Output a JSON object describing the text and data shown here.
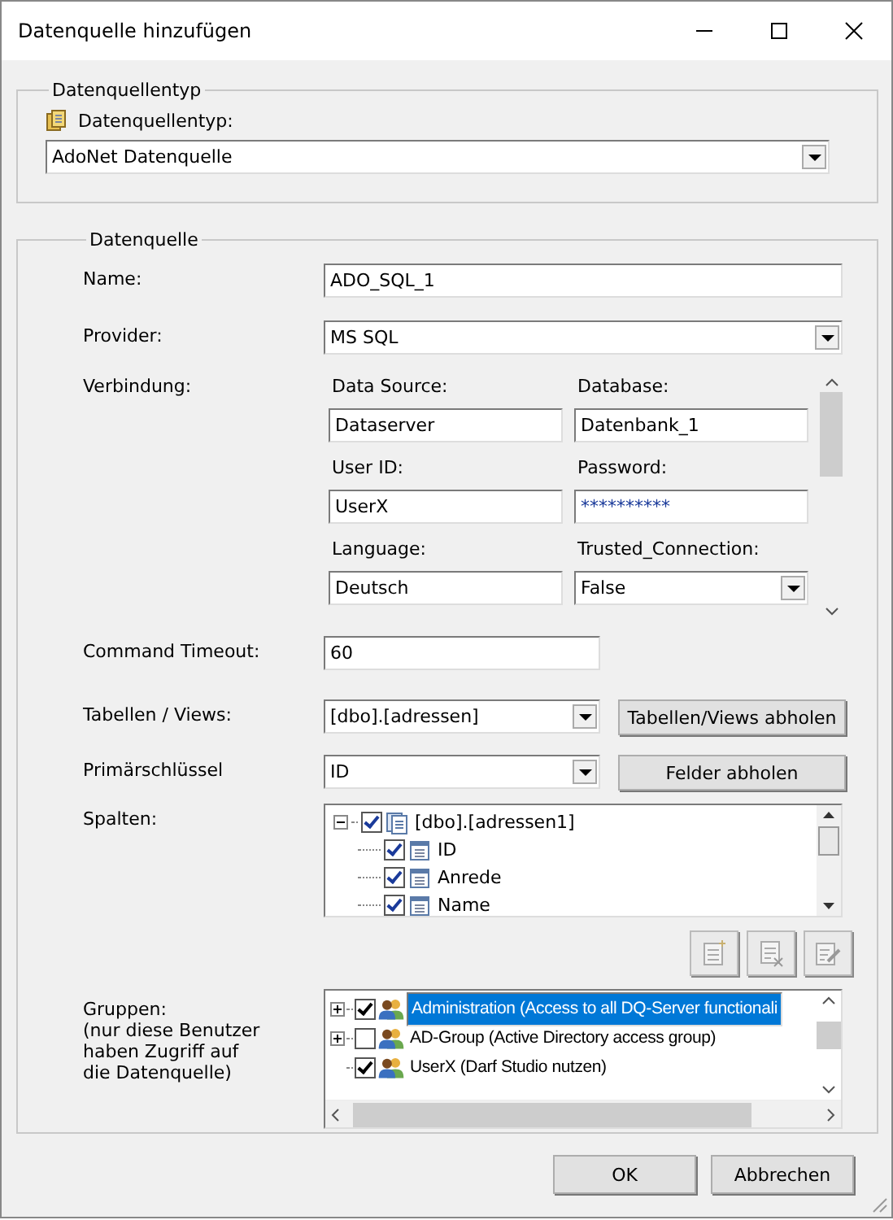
{
  "window": {
    "title": "Datenquelle hinzufügen"
  },
  "type_group": {
    "legend": "Datenquellentyp",
    "label": "Datenquellentyp:",
    "value": "AdoNet Datenquelle"
  },
  "source_group": {
    "legend": "Datenquelle",
    "name": {
      "label": "Name:",
      "value": "ADO_SQL_1"
    },
    "provider": {
      "label": "Provider:",
      "value": "MS SQL"
    },
    "connection": {
      "label": "Verbindung:",
      "fields": [
        {
          "label": "Data Source:",
          "value": "Dataserver",
          "kind": "text"
        },
        {
          "label": "Database:",
          "value": "Datenbank_1",
          "kind": "text"
        },
        {
          "label": "User ID:",
          "value": "UserX",
          "kind": "text"
        },
        {
          "label": "Password:",
          "value": "**********",
          "kind": "password"
        },
        {
          "label": "Language:",
          "value": "Deutsch",
          "kind": "text"
        },
        {
          "label": "Trusted_Connection:",
          "value": "False",
          "kind": "select"
        }
      ]
    },
    "command_timeout": {
      "label": "Command Timeout:",
      "value": "60"
    },
    "tables": {
      "label": "Tabellen / Views:",
      "value": "[dbo].[adressen]",
      "button": "Tabellen/Views abholen"
    },
    "primary_key": {
      "label": "Primärschlüssel",
      "value": "ID",
      "button": "Felder abholen"
    },
    "columns": {
      "label": "Spalten:",
      "tree": {
        "label": "[dbo].[adressen1]",
        "checked": true,
        "expanded": true,
        "children": [
          {
            "label": "ID",
            "checked": true
          },
          {
            "label": "Anrede",
            "checked": true
          },
          {
            "label": "Name",
            "checked": true
          }
        ]
      }
    },
    "groups": {
      "label": "Gruppen:\n(nur diese Benutzer\nhaben Zugriff auf\ndie Datenquelle)",
      "items": [
        {
          "label": "Administration (Access to all DQ-Server functionali",
          "checked": true,
          "selected": true,
          "expander": true
        },
        {
          "label": "AD-Group (Active Directory access group)",
          "checked": false,
          "selected": false,
          "expander": true
        },
        {
          "label": "UserX (Darf Studio nutzen)",
          "checked": true,
          "selected": false,
          "expander": false
        }
      ]
    }
  },
  "buttons": [
    {
      "label": "OK"
    },
    {
      "label": "Abbrechen"
    }
  ]
}
